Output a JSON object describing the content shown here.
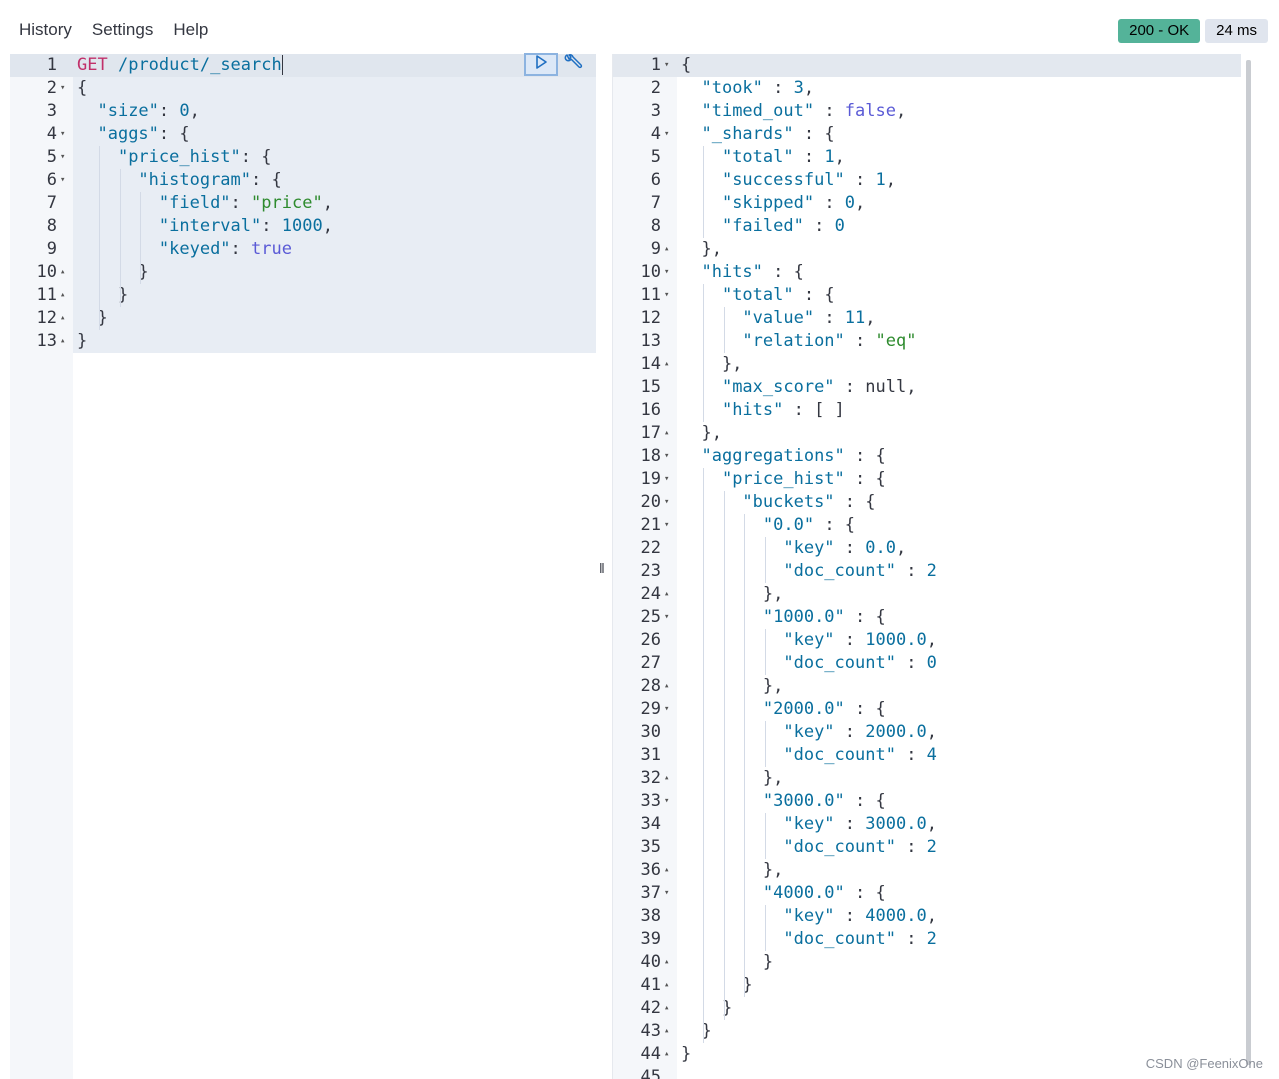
{
  "menu": {
    "history": "History",
    "settings": "Settings",
    "help": "Help"
  },
  "status": {
    "code": "200 - OK",
    "time": "24 ms"
  },
  "request": {
    "method": "GET",
    "path": "/product/_search",
    "lines": [
      {
        "n": "1",
        "fold": "",
        "parts": [
          [
            "method",
            "GET"
          ],
          [
            "punc",
            " "
          ],
          [
            "path",
            "/product/_search"
          ]
        ]
      },
      {
        "n": "2",
        "fold": "▾",
        "parts": [
          [
            "punc",
            "{"
          ]
        ]
      },
      {
        "n": "3",
        "fold": "",
        "parts": [
          [
            "punc",
            "  "
          ],
          [
            "key",
            "\"size\""
          ],
          [
            "punc",
            ": "
          ],
          [
            "num",
            "0"
          ],
          [
            "punc",
            ","
          ]
        ]
      },
      {
        "n": "4",
        "fold": "▾",
        "parts": [
          [
            "punc",
            "  "
          ],
          [
            "key",
            "\"aggs\""
          ],
          [
            "punc",
            ": {"
          ]
        ]
      },
      {
        "n": "5",
        "fold": "▾",
        "parts": [
          [
            "punc",
            "    "
          ],
          [
            "key",
            "\"price_hist\""
          ],
          [
            "punc",
            ": {"
          ]
        ]
      },
      {
        "n": "6",
        "fold": "▾",
        "parts": [
          [
            "punc",
            "      "
          ],
          [
            "key",
            "\"histogram\""
          ],
          [
            "punc",
            ": {"
          ]
        ]
      },
      {
        "n": "7",
        "fold": "",
        "parts": [
          [
            "punc",
            "        "
          ],
          [
            "key",
            "\"field\""
          ],
          [
            "punc",
            ": "
          ],
          [
            "str",
            "\"price\""
          ],
          [
            "punc",
            ","
          ]
        ]
      },
      {
        "n": "8",
        "fold": "",
        "parts": [
          [
            "punc",
            "        "
          ],
          [
            "key",
            "\"interval\""
          ],
          [
            "punc",
            ": "
          ],
          [
            "num",
            "1000"
          ],
          [
            "punc",
            ","
          ]
        ]
      },
      {
        "n": "9",
        "fold": "",
        "parts": [
          [
            "punc",
            "        "
          ],
          [
            "key",
            "\"keyed\""
          ],
          [
            "punc",
            ": "
          ],
          [
            "bool",
            "true"
          ]
        ]
      },
      {
        "n": "10",
        "fold": "▴",
        "parts": [
          [
            "punc",
            "      }"
          ]
        ]
      },
      {
        "n": "11",
        "fold": "▴",
        "parts": [
          [
            "punc",
            "    }"
          ]
        ]
      },
      {
        "n": "12",
        "fold": "▴",
        "parts": [
          [
            "punc",
            "  }"
          ]
        ]
      },
      {
        "n": "13",
        "fold": "▴",
        "parts": [
          [
            "punc",
            "}"
          ]
        ]
      }
    ]
  },
  "response": {
    "lines": [
      {
        "n": "1",
        "fold": "▾",
        "parts": [
          [
            "punc",
            "{"
          ]
        ]
      },
      {
        "n": "2",
        "fold": "",
        "parts": [
          [
            "punc",
            "  "
          ],
          [
            "key",
            "\"took\""
          ],
          [
            "punc",
            " : "
          ],
          [
            "num",
            "3"
          ],
          [
            "punc",
            ","
          ]
        ]
      },
      {
        "n": "3",
        "fold": "",
        "parts": [
          [
            "punc",
            "  "
          ],
          [
            "key",
            "\"timed_out\""
          ],
          [
            "punc",
            " : "
          ],
          [
            "bool",
            "false"
          ],
          [
            "punc",
            ","
          ]
        ]
      },
      {
        "n": "4",
        "fold": "▾",
        "parts": [
          [
            "punc",
            "  "
          ],
          [
            "key",
            "\"_shards\""
          ],
          [
            "punc",
            " : {"
          ]
        ]
      },
      {
        "n": "5",
        "fold": "",
        "parts": [
          [
            "punc",
            "    "
          ],
          [
            "key",
            "\"total\""
          ],
          [
            "punc",
            " : "
          ],
          [
            "num",
            "1"
          ],
          [
            "punc",
            ","
          ]
        ]
      },
      {
        "n": "6",
        "fold": "",
        "parts": [
          [
            "punc",
            "    "
          ],
          [
            "key",
            "\"successful\""
          ],
          [
            "punc",
            " : "
          ],
          [
            "num",
            "1"
          ],
          [
            "punc",
            ","
          ]
        ]
      },
      {
        "n": "7",
        "fold": "",
        "parts": [
          [
            "punc",
            "    "
          ],
          [
            "key",
            "\"skipped\""
          ],
          [
            "punc",
            " : "
          ],
          [
            "num",
            "0"
          ],
          [
            "punc",
            ","
          ]
        ]
      },
      {
        "n": "8",
        "fold": "",
        "parts": [
          [
            "punc",
            "    "
          ],
          [
            "key",
            "\"failed\""
          ],
          [
            "punc",
            " : "
          ],
          [
            "num",
            "0"
          ]
        ]
      },
      {
        "n": "9",
        "fold": "▴",
        "parts": [
          [
            "punc",
            "  },"
          ]
        ]
      },
      {
        "n": "10",
        "fold": "▾",
        "parts": [
          [
            "punc",
            "  "
          ],
          [
            "key",
            "\"hits\""
          ],
          [
            "punc",
            " : {"
          ]
        ]
      },
      {
        "n": "11",
        "fold": "▾",
        "parts": [
          [
            "punc",
            "    "
          ],
          [
            "key",
            "\"total\""
          ],
          [
            "punc",
            " : {"
          ]
        ]
      },
      {
        "n": "12",
        "fold": "",
        "parts": [
          [
            "punc",
            "      "
          ],
          [
            "key",
            "\"value\""
          ],
          [
            "punc",
            " : "
          ],
          [
            "num",
            "11"
          ],
          [
            "punc",
            ","
          ]
        ]
      },
      {
        "n": "13",
        "fold": "",
        "parts": [
          [
            "punc",
            "      "
          ],
          [
            "key",
            "\"relation\""
          ],
          [
            "punc",
            " : "
          ],
          [
            "str",
            "\"eq\""
          ]
        ]
      },
      {
        "n": "14",
        "fold": "▴",
        "parts": [
          [
            "punc",
            "    },"
          ]
        ]
      },
      {
        "n": "15",
        "fold": "",
        "parts": [
          [
            "punc",
            "    "
          ],
          [
            "key",
            "\"max_score\""
          ],
          [
            "punc",
            " : "
          ],
          [
            "null",
            "null"
          ],
          [
            "punc",
            ","
          ]
        ]
      },
      {
        "n": "16",
        "fold": "",
        "parts": [
          [
            "punc",
            "    "
          ],
          [
            "key",
            "\"hits\""
          ],
          [
            "punc",
            " : [ ]"
          ]
        ]
      },
      {
        "n": "17",
        "fold": "▴",
        "parts": [
          [
            "punc",
            "  },"
          ]
        ]
      },
      {
        "n": "18",
        "fold": "▾",
        "parts": [
          [
            "punc",
            "  "
          ],
          [
            "key",
            "\"aggregations\""
          ],
          [
            "punc",
            " : {"
          ]
        ]
      },
      {
        "n": "19",
        "fold": "▾",
        "parts": [
          [
            "punc",
            "    "
          ],
          [
            "key",
            "\"price_hist\""
          ],
          [
            "punc",
            " : {"
          ]
        ]
      },
      {
        "n": "20",
        "fold": "▾",
        "parts": [
          [
            "punc",
            "      "
          ],
          [
            "key",
            "\"buckets\""
          ],
          [
            "punc",
            " : {"
          ]
        ]
      },
      {
        "n": "21",
        "fold": "▾",
        "parts": [
          [
            "punc",
            "        "
          ],
          [
            "key",
            "\"0.0\""
          ],
          [
            "punc",
            " : {"
          ]
        ]
      },
      {
        "n": "22",
        "fold": "",
        "parts": [
          [
            "punc",
            "          "
          ],
          [
            "key",
            "\"key\""
          ],
          [
            "punc",
            " : "
          ],
          [
            "num",
            "0.0"
          ],
          [
            "punc",
            ","
          ]
        ]
      },
      {
        "n": "23",
        "fold": "",
        "parts": [
          [
            "punc",
            "          "
          ],
          [
            "key",
            "\"doc_count\""
          ],
          [
            "punc",
            " : "
          ],
          [
            "num",
            "2"
          ]
        ]
      },
      {
        "n": "24",
        "fold": "▴",
        "parts": [
          [
            "punc",
            "        },"
          ]
        ]
      },
      {
        "n": "25",
        "fold": "▾",
        "parts": [
          [
            "punc",
            "        "
          ],
          [
            "key",
            "\"1000.0\""
          ],
          [
            "punc",
            " : {"
          ]
        ]
      },
      {
        "n": "26",
        "fold": "",
        "parts": [
          [
            "punc",
            "          "
          ],
          [
            "key",
            "\"key\""
          ],
          [
            "punc",
            " : "
          ],
          [
            "num",
            "1000.0"
          ],
          [
            "punc",
            ","
          ]
        ]
      },
      {
        "n": "27",
        "fold": "",
        "parts": [
          [
            "punc",
            "          "
          ],
          [
            "key",
            "\"doc_count\""
          ],
          [
            "punc",
            " : "
          ],
          [
            "num",
            "0"
          ]
        ]
      },
      {
        "n": "28",
        "fold": "▴",
        "parts": [
          [
            "punc",
            "        },"
          ]
        ]
      },
      {
        "n": "29",
        "fold": "▾",
        "parts": [
          [
            "punc",
            "        "
          ],
          [
            "key",
            "\"2000.0\""
          ],
          [
            "punc",
            " : {"
          ]
        ]
      },
      {
        "n": "30",
        "fold": "",
        "parts": [
          [
            "punc",
            "          "
          ],
          [
            "key",
            "\"key\""
          ],
          [
            "punc",
            " : "
          ],
          [
            "num",
            "2000.0"
          ],
          [
            "punc",
            ","
          ]
        ]
      },
      {
        "n": "31",
        "fold": "",
        "parts": [
          [
            "punc",
            "          "
          ],
          [
            "key",
            "\"doc_count\""
          ],
          [
            "punc",
            " : "
          ],
          [
            "num",
            "4"
          ]
        ]
      },
      {
        "n": "32",
        "fold": "▴",
        "parts": [
          [
            "punc",
            "        },"
          ]
        ]
      },
      {
        "n": "33",
        "fold": "▾",
        "parts": [
          [
            "punc",
            "        "
          ],
          [
            "key",
            "\"3000.0\""
          ],
          [
            "punc",
            " : {"
          ]
        ]
      },
      {
        "n": "34",
        "fold": "",
        "parts": [
          [
            "punc",
            "          "
          ],
          [
            "key",
            "\"key\""
          ],
          [
            "punc",
            " : "
          ],
          [
            "num",
            "3000.0"
          ],
          [
            "punc",
            ","
          ]
        ]
      },
      {
        "n": "35",
        "fold": "",
        "parts": [
          [
            "punc",
            "          "
          ],
          [
            "key",
            "\"doc_count\""
          ],
          [
            "punc",
            " : "
          ],
          [
            "num",
            "2"
          ]
        ]
      },
      {
        "n": "36",
        "fold": "▴",
        "parts": [
          [
            "punc",
            "        },"
          ]
        ]
      },
      {
        "n": "37",
        "fold": "▾",
        "parts": [
          [
            "punc",
            "        "
          ],
          [
            "key",
            "\"4000.0\""
          ],
          [
            "punc",
            " : {"
          ]
        ]
      },
      {
        "n": "38",
        "fold": "",
        "parts": [
          [
            "punc",
            "          "
          ],
          [
            "key",
            "\"key\""
          ],
          [
            "punc",
            " : "
          ],
          [
            "num",
            "4000.0"
          ],
          [
            "punc",
            ","
          ]
        ]
      },
      {
        "n": "39",
        "fold": "",
        "parts": [
          [
            "punc",
            "          "
          ],
          [
            "key",
            "\"doc_count\""
          ],
          [
            "punc",
            " : "
          ],
          [
            "num",
            "2"
          ]
        ]
      },
      {
        "n": "40",
        "fold": "▴",
        "parts": [
          [
            "punc",
            "        }"
          ]
        ]
      },
      {
        "n": "41",
        "fold": "▴",
        "parts": [
          [
            "punc",
            "      }"
          ]
        ]
      },
      {
        "n": "42",
        "fold": "▴",
        "parts": [
          [
            "punc",
            "    }"
          ]
        ]
      },
      {
        "n": "43",
        "fold": "▴",
        "parts": [
          [
            "punc",
            "  }"
          ]
        ]
      },
      {
        "n": "44",
        "fold": "▴",
        "parts": [
          [
            "punc",
            "}"
          ]
        ]
      },
      {
        "n": "45",
        "fold": "",
        "parts": []
      }
    ]
  },
  "icons": {
    "run": "play-icon",
    "settings": "wrench-icon",
    "divider": "resize-handle-icon"
  },
  "divider_glyph": "‖",
  "watermark": "CSDN @FeenixOne",
  "colors": {
    "status_ok": "#54b399",
    "method": "#c1306a",
    "key": "#0a6f9e",
    "string": "#2e8b2e",
    "bool": "#5a5ad6"
  }
}
